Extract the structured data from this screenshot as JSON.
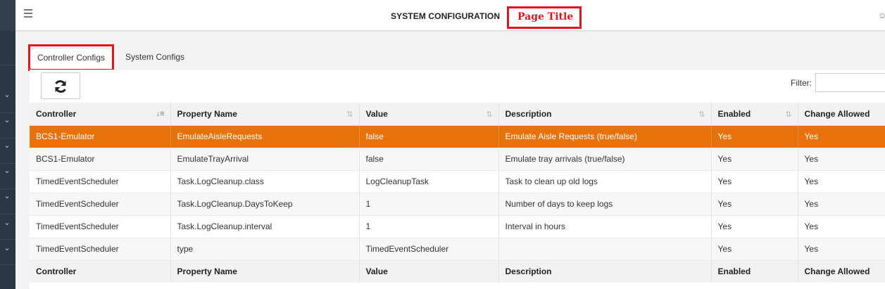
{
  "header": {
    "title": "SYSTEM CONFIGURATION",
    "annotation": "Page Title"
  },
  "tabs": [
    {
      "label": "Controller Configs",
      "active": true
    },
    {
      "label": "System Configs",
      "active": false
    }
  ],
  "toolbar": {
    "filter_label": "Filter:",
    "filter_value": ""
  },
  "table": {
    "columns": [
      "Controller",
      "Property Name",
      "Value",
      "Description",
      "Enabled",
      "Change Allowed"
    ],
    "rows": [
      [
        "BCS1-Emulator",
        "EmulateAisleRequests",
        "false",
        "Emulate Aisle Requests (true/false)",
        "Yes",
        "Yes"
      ],
      [
        "BCS1-Emulator",
        "EmulateTrayArrival",
        "false",
        "Emulate tray arrivals (true/false)",
        "Yes",
        "Yes"
      ],
      [
        "TimedEventScheduler",
        "Task.LogCleanup.class",
        "LogCleanupTask",
        "Task to clean up old logs",
        "Yes",
        "Yes"
      ],
      [
        "TimedEventScheduler",
        "Task.LogCleanup.DaysToKeep",
        "1",
        "Number of days to keep logs",
        "Yes",
        "Yes"
      ],
      [
        "TimedEventScheduler",
        "Task.LogCleanup.interval",
        "1",
        "Interval in hours",
        "Yes",
        "Yes"
      ],
      [
        "TimedEventScheduler",
        "type",
        "TimedEventScheduler",
        "",
        "Yes",
        "Yes"
      ]
    ],
    "footer": [
      "Controller",
      "Property Name",
      "Value",
      "Description",
      "Enabled",
      "Change Allowed"
    ]
  },
  "colors": {
    "selected_row": "#e6720c",
    "annotation_red": "#e0141e",
    "sidebar": "#2c3745"
  },
  "icons": {
    "menu": "hamburger-icon",
    "refresh": "refresh-icon",
    "sort": "sort-icon",
    "user": "user-icon"
  }
}
